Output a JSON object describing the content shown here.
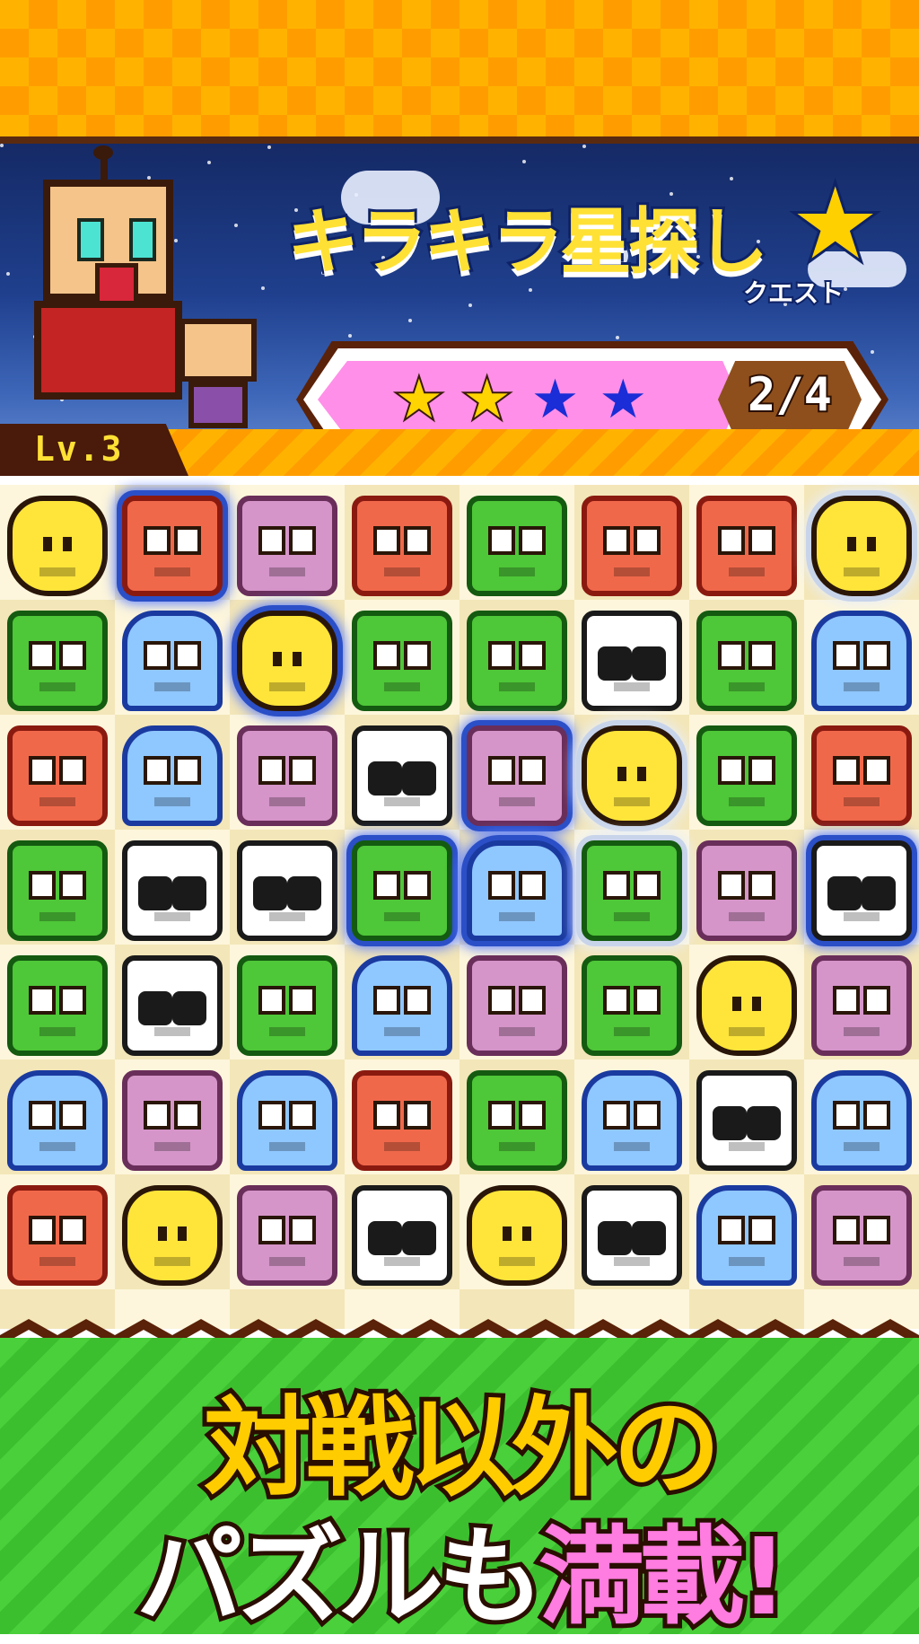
{
  "header": {
    "level": "Lv.3"
  },
  "title": {
    "main": "キラキラ星探し",
    "sub": "クエスト"
  },
  "progress": {
    "stars_total": 4,
    "stars_collected": 2,
    "count_text": "2/4"
  },
  "board": {
    "columns": 8,
    "rows": [
      [
        "giraffe",
        "monkey",
        "hippo",
        "monkey",
        "frog",
        "monkey",
        "monkey",
        "giraffe"
      ],
      [
        "frog",
        "elephant",
        "giraffe",
        "frog",
        "frog",
        "panda",
        "frog",
        "elephant"
      ],
      [
        "monkey",
        "elephant",
        "hippo",
        "panda",
        "hippo",
        "giraffe",
        "frog",
        "monkey"
      ],
      [
        "frog",
        "panda",
        "panda",
        "frog",
        "elephant",
        "frog",
        "hippo",
        "panda"
      ],
      [
        "frog",
        "panda",
        "frog",
        "elephant",
        "hippo",
        "frog",
        "giraffe",
        "hippo"
      ],
      [
        "elephant",
        "hippo",
        "elephant",
        "monkey",
        "frog",
        "elephant",
        "panda",
        "elephant"
      ],
      [
        "monkey",
        "giraffe",
        "hippo",
        "panda",
        "giraffe",
        "panda",
        "elephant",
        "hippo"
      ]
    ],
    "highlighted": [
      {
        "r": 0,
        "c": 1,
        "style": "blue"
      },
      {
        "r": 0,
        "c": 7,
        "style": "white"
      },
      {
        "r": 1,
        "c": 2,
        "style": "blue"
      },
      {
        "r": 2,
        "c": 4,
        "style": "blue"
      },
      {
        "r": 2,
        "c": 5,
        "style": "white"
      },
      {
        "r": 3,
        "c": 3,
        "style": "blue"
      },
      {
        "r": 3,
        "c": 4,
        "style": "blue"
      },
      {
        "r": 3,
        "c": 5,
        "style": "white"
      },
      {
        "r": 3,
        "c": 7,
        "style": "blue"
      }
    ]
  },
  "promo": {
    "line1": "対戦以外の",
    "line2_white": "パズルも",
    "line2_pink": "満載!"
  },
  "colors": {
    "accent_yellow": "#ffcc00",
    "accent_pink": "#ff7ce0",
    "grass": "#49d03a"
  }
}
